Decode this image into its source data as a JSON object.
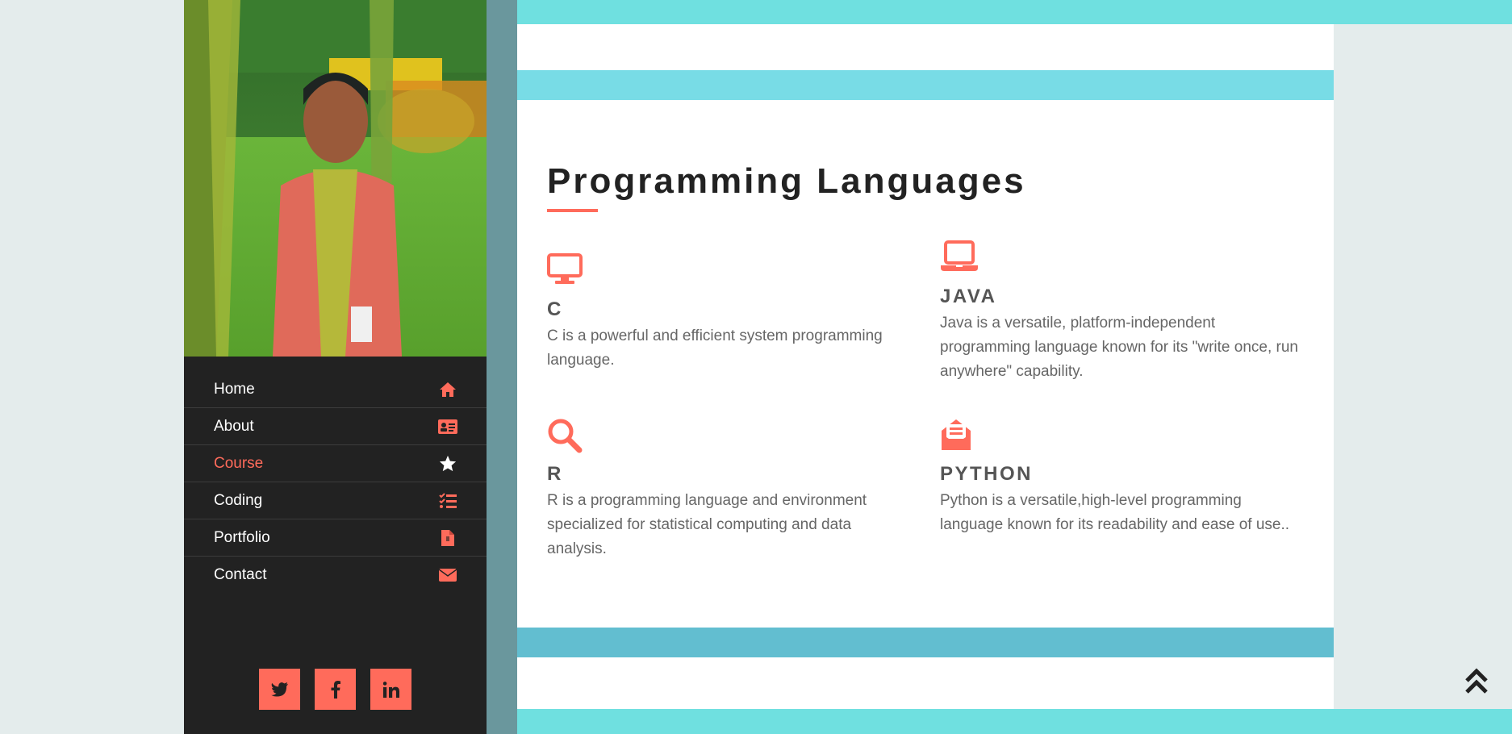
{
  "nav": {
    "items": [
      {
        "label": "Home",
        "icon": "home-icon"
      },
      {
        "label": "About",
        "icon": "id-card-icon"
      },
      {
        "label": "Course",
        "icon": "star-icon",
        "active": true
      },
      {
        "label": "Coding",
        "icon": "tasks-icon"
      },
      {
        "label": "Portfolio",
        "icon": "file-icon"
      },
      {
        "label": "Contact",
        "icon": "envelope-icon"
      }
    ]
  },
  "socials": [
    "twitter-icon",
    "facebook-icon",
    "linkedin-icon"
  ],
  "section": {
    "title": "Programming Languages",
    "features": [
      {
        "title": "C",
        "text": "C is a powerful and efficient system programming language.",
        "icon": "desktop-icon"
      },
      {
        "title": "JAVA",
        "text": "Java is a versatile, platform-independent programming language known for its \"write once, run anywhere\" capability.",
        "icon": "laptop-icon"
      },
      {
        "title": "R",
        "text": "R is a programming language and environment specialized for statistical computing and data analysis.",
        "icon": "search-icon"
      },
      {
        "title": "PYTHON",
        "text": "Python is a versatile,high-level programming language known for its readability and ease of use..",
        "icon": "envelope-open-icon"
      }
    ]
  },
  "colors": {
    "accent": "#ff6b5b",
    "sidebar": "#222222",
    "band": "#6fe0e0"
  }
}
